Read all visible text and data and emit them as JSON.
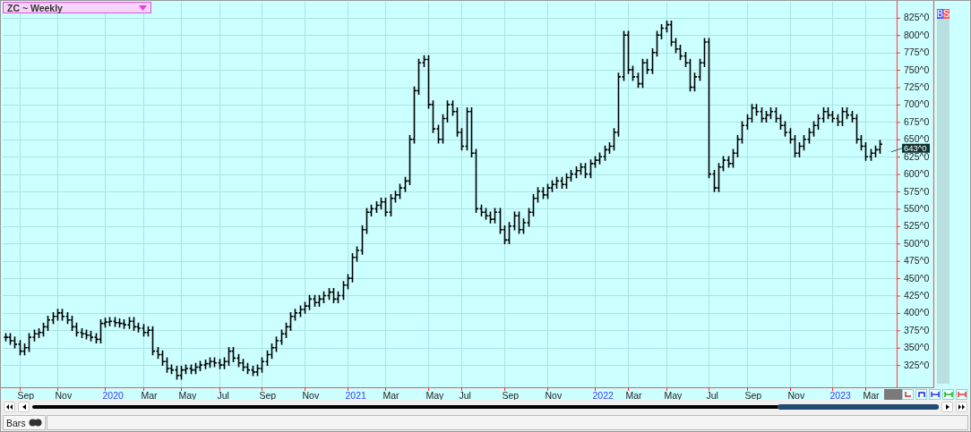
{
  "chart_title": {
    "label": "ZC ~ Weekly"
  },
  "badges": [
    {
      "label": "B",
      "color": "#5a5aff"
    },
    {
      "label": "S",
      "color": "#ff5a5a"
    }
  ],
  "chart": {
    "kind": "bars",
    "price_axis_labels": [
      "825^0",
      "800^0",
      "775^0",
      "750^0",
      "725^0",
      "700^0",
      "675^0",
      "650^0",
      "625^0",
      "600^0",
      "575^0",
      "550^0",
      "525^0",
      "500^0",
      "475^0",
      "450^0",
      "425^0",
      "400^0",
      "375^0",
      "350^0",
      "325^0"
    ],
    "time_axis_labels": [
      "Sep",
      "Nov",
      "2020",
      "Mar",
      "May",
      "Jul",
      "Sep",
      "Nov",
      "2021",
      "Mar",
      "May",
      "Jul",
      "Sep",
      "Nov",
      "2022",
      "Mar",
      "May",
      "Jul",
      "Sep",
      "Nov",
      "2023",
      "Mar"
    ],
    "last_price_label": "643^0"
  },
  "status_tabs": [
    {
      "label": "Bars"
    }
  ]
}
